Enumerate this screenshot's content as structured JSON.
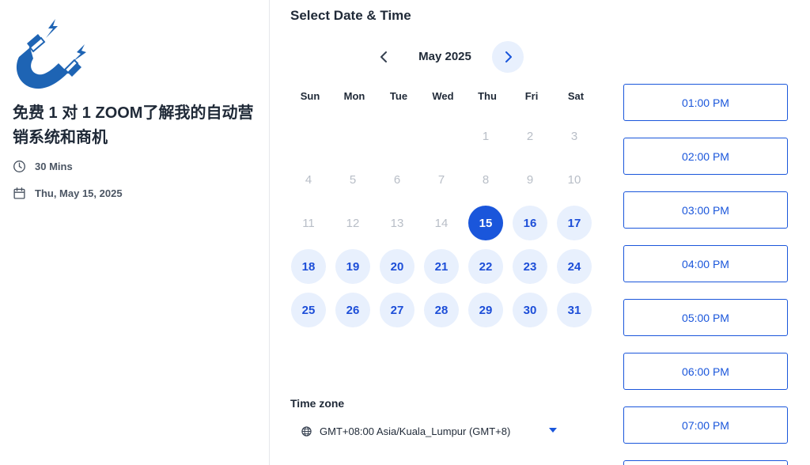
{
  "event": {
    "title": "免费 1 对 1 ZOOM了解我的自动营销系统和商机",
    "duration": "30 Mins",
    "date": "Thu, May 15, 2025"
  },
  "scheduler": {
    "heading": "Select Date & Time",
    "month": "May 2025",
    "weekdays": [
      "Sun",
      "Mon",
      "Tue",
      "Wed",
      "Thu",
      "Fri",
      "Sat"
    ],
    "days": {
      "1": "1",
      "2": "2",
      "3": "3",
      "4": "4",
      "5": "5",
      "6": "6",
      "7": "7",
      "8": "8",
      "9": "9",
      "10": "10",
      "11": "11",
      "12": "12",
      "13": "13",
      "14": "14",
      "15": "15",
      "16": "16",
      "17": "17",
      "18": "18",
      "19": "19",
      "20": "20",
      "21": "21",
      "22": "22",
      "23": "23",
      "24": "24",
      "25": "25",
      "26": "26",
      "27": "27",
      "28": "28",
      "29": "29",
      "30": "30",
      "31": "31"
    },
    "first_available_day": 15,
    "selected_day": 15
  },
  "timezone": {
    "label": "Time zone",
    "value": "GMT+08:00 Asia/Kuala_Lumpur (GMT+8)"
  },
  "slots": [
    "01:00 PM",
    "02:00 PM",
    "03:00 PM",
    "04:00 PM",
    "05:00 PM",
    "06:00 PM",
    "07:00 PM"
  ],
  "colors": {
    "accent": "#1a56db",
    "available_bg": "#e8f0fd",
    "disabled_text": "#b8bec7",
    "logo_blue": "#1e64b4"
  },
  "icons": {
    "logo": "magnet-icon",
    "duration": "clock-icon",
    "date": "calendar-icon",
    "prev": "chevron-left-icon",
    "next": "chevron-right-icon",
    "timezone": "globe-icon",
    "dropdown": "caret-down-icon"
  }
}
